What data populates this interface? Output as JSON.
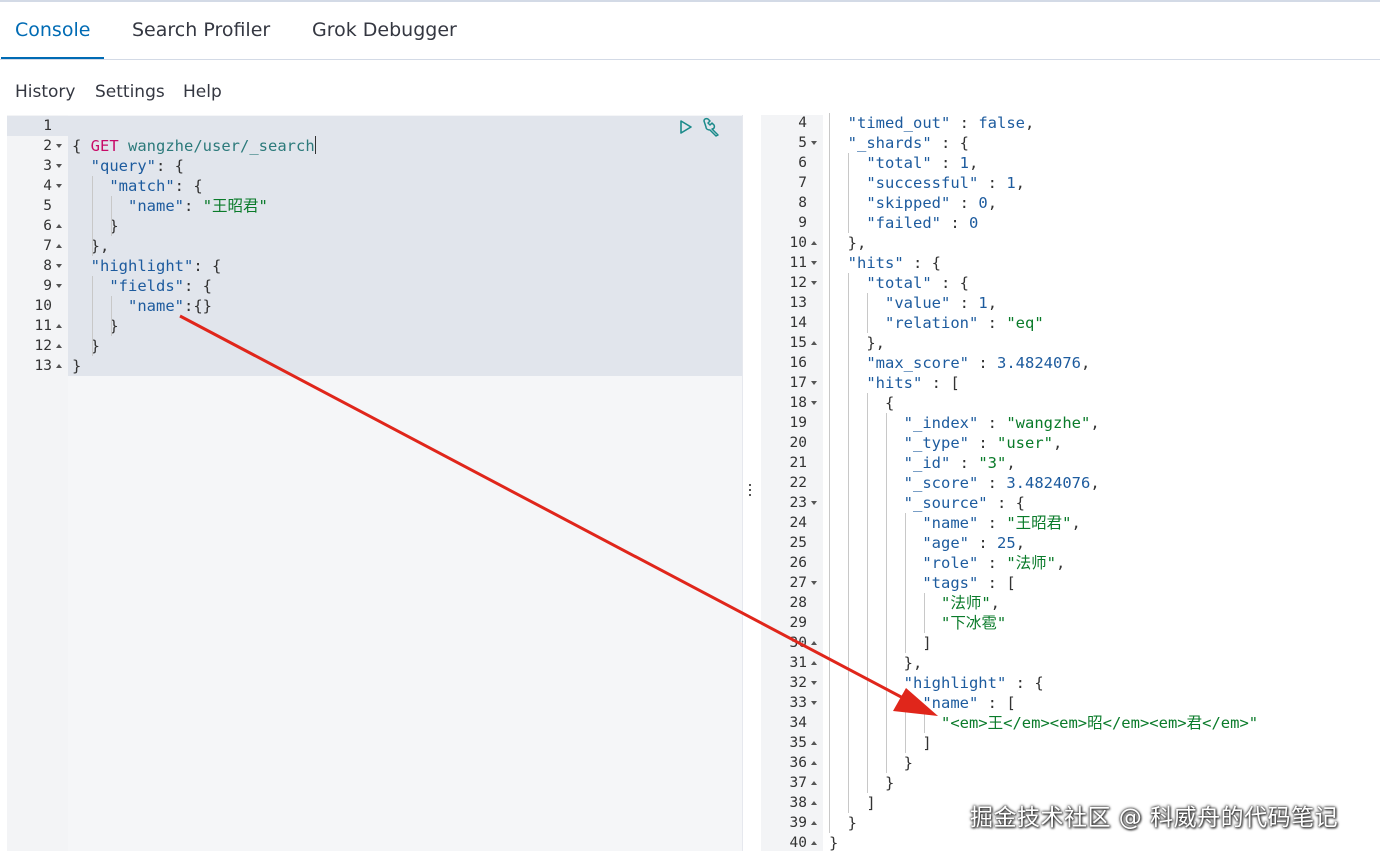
{
  "tabs": [
    {
      "label": "Console",
      "active": true
    },
    {
      "label": "Search Profiler",
      "active": false
    },
    {
      "label": "Grok Debugger",
      "active": false
    }
  ],
  "menu": [
    {
      "label": "History"
    },
    {
      "label": "Settings"
    },
    {
      "label": "Help"
    }
  ],
  "request": {
    "line_numbers": [
      "1",
      "2",
      "3",
      "4",
      "5",
      "6",
      "7",
      "8",
      "9",
      "10",
      "11",
      "12",
      "13"
    ],
    "method": "GET",
    "url": "wangzhe/user/_search",
    "lines": [
      "{",
      "  \"query\": {",
      "    \"match\": {",
      "      \"name\": \"王昭君\"",
      "    }",
      "  },",
      "  \"highlight\": {",
      "    \"fields\": {",
      "      \"name\":{}",
      "    }",
      "  }",
      "}"
    ],
    "run_icon": "play-icon",
    "settings_icon": "wrench-icon"
  },
  "response": {
    "line_numbers": [
      "4",
      "5",
      "6",
      "7",
      "8",
      "9",
      "10",
      "11",
      "12",
      "13",
      "14",
      "15",
      "16",
      "17",
      "18",
      "19",
      "20",
      "21",
      "22",
      "23",
      "24",
      "25",
      "26",
      "27",
      "28",
      "29",
      "30",
      "31",
      "32",
      "33",
      "34",
      "35",
      "36",
      "37",
      "38",
      "39",
      "40"
    ],
    "lines": [
      "  \"timed_out\" : false,",
      "  \"_shards\" : {",
      "    \"total\" : 1,",
      "    \"successful\" : 1,",
      "    \"skipped\" : 0,",
      "    \"failed\" : 0",
      "  },",
      "  \"hits\" : {",
      "    \"total\" : {",
      "      \"value\" : 1,",
      "      \"relation\" : \"eq\"",
      "    },",
      "    \"max_score\" : 3.4824076,",
      "    \"hits\" : [",
      "      {",
      "        \"_index\" : \"wangzhe\",",
      "        \"_type\" : \"user\",",
      "        \"_id\" : \"3\",",
      "        \"_score\" : 3.4824076,",
      "        \"_source\" : {",
      "          \"name\" : \"王昭君\",",
      "          \"age\" : 25,",
      "          \"role\" : \"法师\",",
      "          \"tags\" : [",
      "            \"法师\",",
      "            \"下冰雹\"",
      "          ]",
      "        },",
      "        \"highlight\" : {",
      "          \"name\" : [",
      "            \"<em>王</em><em>昭</em><em>君</em>\"",
      "          ]",
      "        }",
      "      }",
      "    ]",
      "  }",
      "}"
    ]
  },
  "divider_icon": "drag-handle-icon",
  "watermark": "掘金技术社区 @ 科威舟的代码笔记",
  "colors": {
    "accent": "#006bb4",
    "method": "#c80a68",
    "string": "#0a7b2a",
    "key": "#1d5b9e",
    "arrow": "#e0261b"
  }
}
